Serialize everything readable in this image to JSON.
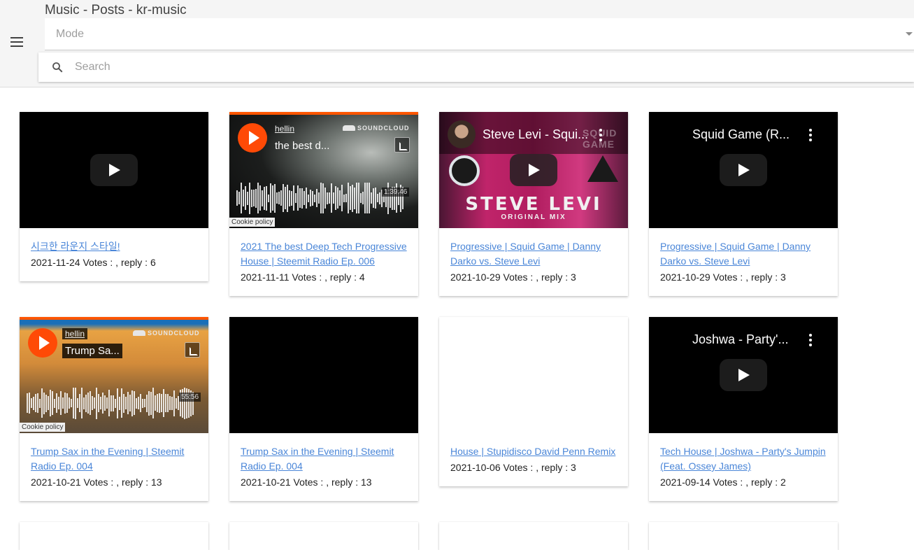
{
  "header": {
    "title": "Music - Posts - kr-music",
    "menu_icon": "hamburger-menu-icon",
    "mode_label": "Mode",
    "search_placeholder": "Search",
    "search_icon": "search-icon"
  },
  "posts": [
    {
      "title": "시크한 라운지 스타일!",
      "meta": "2021-11-24 Votes : , reply : 6",
      "media": "youtube"
    },
    {
      "title": "2021 The best Deep Tech Progressive House | Steemit Radio Ep. 006",
      "meta": "2021-11-11 Votes : , reply : 4",
      "media": "soundcloud",
      "player": {
        "user": "hellin",
        "track": "the best d...",
        "brand": "SOUNDCLOUD",
        "duration": "1:39:46",
        "cookie": "Cookie policy"
      }
    },
    {
      "title": "Progressive | Squid Game | Danny Darko vs. Steve Levi",
      "meta": "2021-10-29 Votes : , reply : 3",
      "media": "youtube",
      "player": {
        "video_title": "Steve Levi - Squi...",
        "thumb_big": "STEVE LEVI",
        "thumb_small": "ORIGINAL MIX",
        "thumb_logo": "SQUID GAME"
      }
    },
    {
      "title": "Progressive | Squid Game | Danny Darko vs. Steve Levi",
      "meta": "2021-10-29 Votes : , reply : 3",
      "media": "youtube",
      "player": {
        "video_title": "Squid Game (R..."
      }
    },
    {
      "title": "Trump Sax in the Evening | Steemit Radio Ep. 004",
      "meta": "2021-10-21 Votes : , reply : 13",
      "media": "soundcloud",
      "player": {
        "user": "hellin",
        "track": "Trump Sa...",
        "brand": "SOUNDCLOUD",
        "duration": "55:56",
        "cookie": "Cookie policy"
      }
    },
    {
      "title": "Trump Sax in the Evening | Steemit Radio Ep. 004",
      "meta": "2021-10-21 Votes : , reply : 13",
      "media": "black"
    },
    {
      "title": "House | Stupidisco David Penn Remix",
      "meta": "2021-10-06 Votes : , reply : 3",
      "media": "blank"
    },
    {
      "title": "Tech House | Joshwa - Party's Jumpin (Feat. Ossey James)",
      "meta": "2021-09-14 Votes : , reply : 2",
      "media": "youtube",
      "player": {
        "video_title": "Joshwa - Party'..."
      }
    }
  ],
  "colors": {
    "link": "#4a86d8",
    "soundcloud_orange": "#ff5500",
    "header_bg": "#f5f5f5"
  }
}
